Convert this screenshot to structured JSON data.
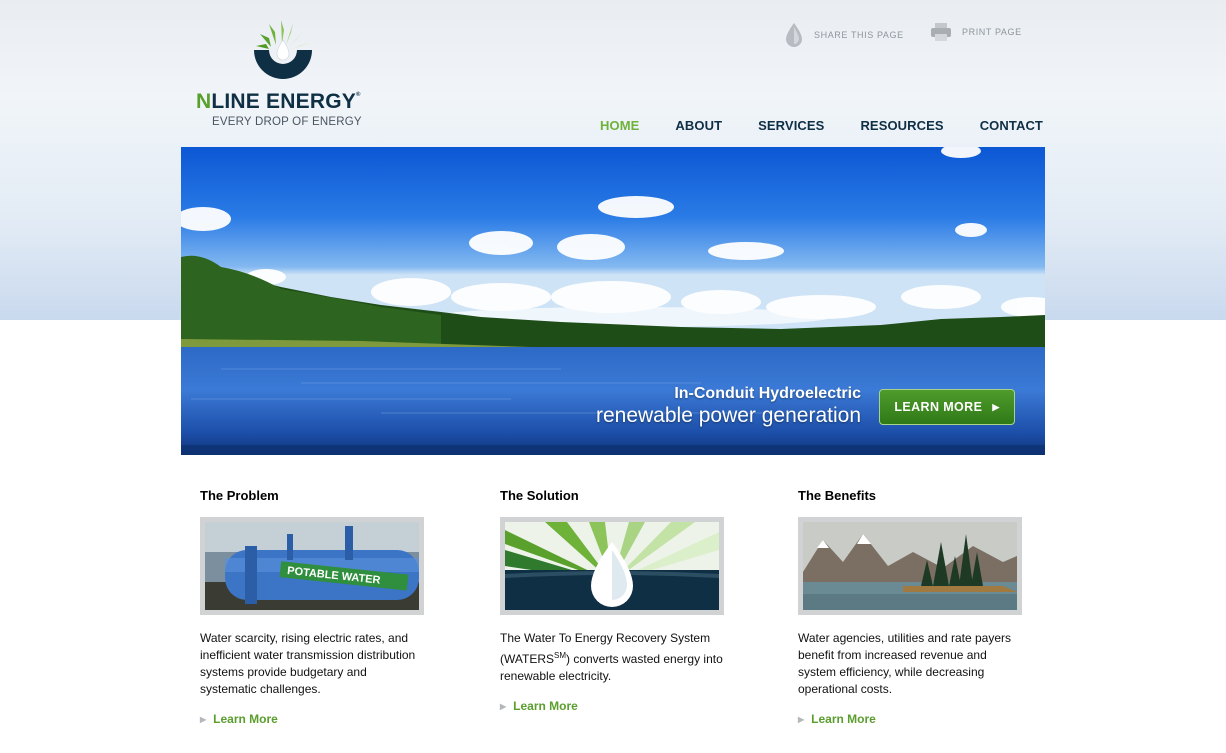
{
  "brand": {
    "name_first": "N",
    "name_rest": "LINE ENERGY",
    "trademark": "®",
    "tagline": "EVERY DROP OF ENERGY"
  },
  "utility": {
    "share": "SHARE THIS PAGE",
    "print": "PRINT PAGE"
  },
  "nav": {
    "items": [
      {
        "label": "HOME",
        "active": true
      },
      {
        "label": "ABOUT"
      },
      {
        "label": "SERVICES"
      },
      {
        "label": "RESOURCES"
      },
      {
        "label": "CONTACT"
      }
    ]
  },
  "hero": {
    "caption_line1": "In-Conduit Hydroelectric",
    "caption_line2": "renewable power generation",
    "button_label": "LEARN MORE"
  },
  "columns": [
    {
      "title": "The Problem",
      "text": "Water scarcity, rising electric rates, and inefficient water transmission distribution systems provide budgetary and systematic challenges.",
      "image_text": "POTABLE WATER",
      "link": "Learn More"
    },
    {
      "title": "The Solution",
      "text_before": "The Water To Energy Recovery System (WATERS",
      "text_sup": "SM",
      "text_after": ") converts wasted energy into renewable electricity.",
      "link": "Learn More"
    },
    {
      "title": "The Benefits",
      "text": "Water agencies, utilities and rate payers benefit from increased revenue and system efficiency, while decreasing operational costs.",
      "link": "Learn More"
    }
  ],
  "colors": {
    "navy": "#0f2f44",
    "green": "#6fb23a",
    "link_green": "#5a9e2e"
  }
}
